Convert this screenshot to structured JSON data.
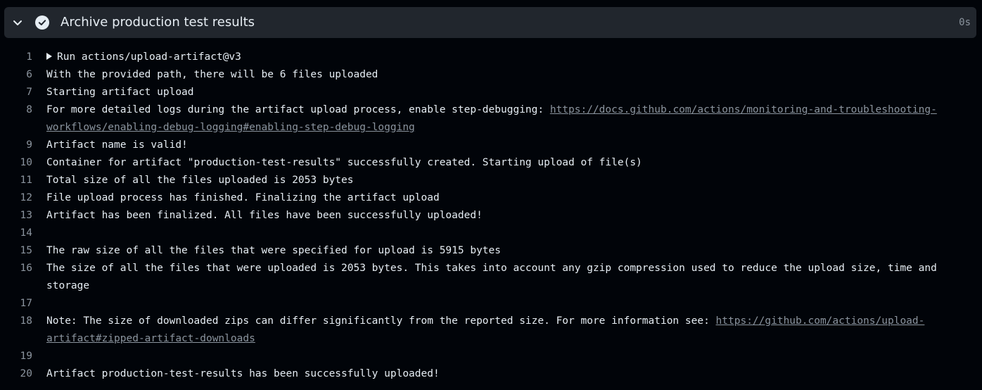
{
  "step": {
    "title": "Archive production test results",
    "duration": "0s",
    "status": "success",
    "collapse_icon": "chevron-down-icon",
    "status_icon": "check-circle-icon"
  },
  "colors": {
    "background": "#010409",
    "header_bg": "#21262d",
    "text": "#e6edf3",
    "muted": "#8b949e"
  },
  "log": {
    "lines": [
      {
        "num": "1",
        "text": "Run actions/upload-artifact@v3",
        "group": true
      },
      {
        "num": "6",
        "text": "With the provided path, there will be 6 files uploaded"
      },
      {
        "num": "7",
        "text": "Starting artifact upload"
      },
      {
        "num": "8",
        "text": "For more detailed logs during the artifact upload process, enable step-debugging: ",
        "link": "https://docs.github.com/actions/monitoring-and-troubleshooting-workflows/enabling-debug-logging#enabling-step-debug-logging"
      },
      {
        "num": "9",
        "text": "Artifact name is valid!"
      },
      {
        "num": "10",
        "text": "Container for artifact \"production-test-results\" successfully created. Starting upload of file(s)"
      },
      {
        "num": "11",
        "text": "Total size of all the files uploaded is 2053 bytes"
      },
      {
        "num": "12",
        "text": "File upload process has finished. Finalizing the artifact upload"
      },
      {
        "num": "13",
        "text": "Artifact has been finalized. All files have been successfully uploaded!"
      },
      {
        "num": "14",
        "text": ""
      },
      {
        "num": "15",
        "text": "The raw size of all the files that were specified for upload is 5915 bytes"
      },
      {
        "num": "16",
        "text": "The size of all the files that were uploaded is 2053 bytes. This takes into account any gzip compression used to reduce the upload size, time and storage"
      },
      {
        "num": "17",
        "text": ""
      },
      {
        "num": "18",
        "text": "Note: The size of downloaded zips can differ significantly from the reported size. For more information see: ",
        "link": "https://github.com/actions/upload-artifact#zipped-artifact-downloads"
      },
      {
        "num": "19",
        "text": ""
      },
      {
        "num": "20",
        "text": "Artifact production-test-results has been successfully uploaded!"
      }
    ]
  }
}
